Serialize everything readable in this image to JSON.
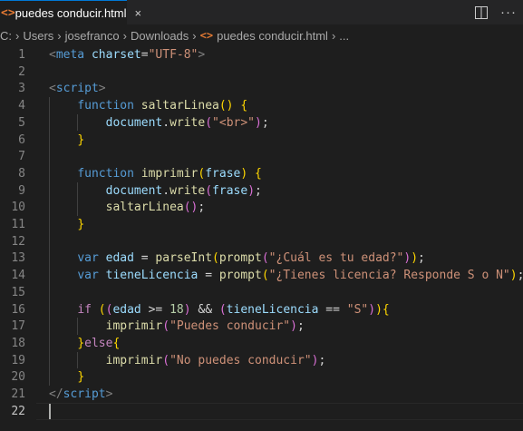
{
  "tab": {
    "icon": "<>",
    "title": "puedes conducir.html",
    "close": "×"
  },
  "actions": {
    "split": "split-editor-icon",
    "more": "···"
  },
  "breadcrumb": {
    "items": [
      "C:",
      "Users",
      "josefranco",
      "Downloads"
    ],
    "separator": "›",
    "file_icon": "<>",
    "file": "puedes conducir.html",
    "trail": "..."
  },
  "editor": {
    "current_line": 22,
    "lines": [
      {
        "n": "1",
        "tokens": [
          [
            "t-br",
            "<"
          ],
          [
            "t-tag",
            "meta"
          ],
          [
            "t-p",
            " "
          ],
          [
            "t-attr",
            "charset"
          ],
          [
            "t-p",
            "="
          ],
          [
            "t-str",
            "\"UTF-8\""
          ],
          [
            "t-br",
            ">"
          ]
        ]
      },
      {
        "n": "2",
        "tokens": []
      },
      {
        "n": "3",
        "tokens": [
          [
            "t-br",
            "<"
          ],
          [
            "t-tag",
            "script"
          ],
          [
            "t-br",
            ">"
          ]
        ]
      },
      {
        "n": "4",
        "tokens": [
          [
            "t-p",
            "    "
          ],
          [
            "t-kw",
            "function"
          ],
          [
            "t-p",
            " "
          ],
          [
            "t-fn",
            "saltarLinea"
          ],
          [
            "t-b1",
            "()"
          ],
          [
            "t-p",
            " "
          ],
          [
            "t-b1",
            "{"
          ]
        ]
      },
      {
        "n": "5",
        "tokens": [
          [
            "t-p",
            "        "
          ],
          [
            "t-var",
            "document"
          ],
          [
            "t-p",
            "."
          ],
          [
            "t-fn",
            "write"
          ],
          [
            "t-b2",
            "("
          ],
          [
            "t-str",
            "\"<br>\""
          ],
          [
            "t-b2",
            ")"
          ],
          [
            "t-p",
            ";"
          ]
        ]
      },
      {
        "n": "6",
        "tokens": [
          [
            "t-p",
            "    "
          ],
          [
            "t-b1",
            "}"
          ]
        ]
      },
      {
        "n": "7",
        "tokens": []
      },
      {
        "n": "8",
        "tokens": [
          [
            "t-p",
            "    "
          ],
          [
            "t-kw",
            "function"
          ],
          [
            "t-p",
            " "
          ],
          [
            "t-fn",
            "imprimir"
          ],
          [
            "t-b1",
            "("
          ],
          [
            "t-var",
            "frase"
          ],
          [
            "t-b1",
            ")"
          ],
          [
            "t-p",
            " "
          ],
          [
            "t-b1",
            "{"
          ]
        ]
      },
      {
        "n": "9",
        "tokens": [
          [
            "t-p",
            "        "
          ],
          [
            "t-var",
            "document"
          ],
          [
            "t-p",
            "."
          ],
          [
            "t-fn",
            "write"
          ],
          [
            "t-b2",
            "("
          ],
          [
            "t-var",
            "frase"
          ],
          [
            "t-b2",
            ")"
          ],
          [
            "t-p",
            ";"
          ]
        ]
      },
      {
        "n": "10",
        "tokens": [
          [
            "t-p",
            "        "
          ],
          [
            "t-fn",
            "saltarLinea"
          ],
          [
            "t-b2",
            "()"
          ],
          [
            "t-p",
            ";"
          ]
        ]
      },
      {
        "n": "11",
        "tokens": [
          [
            "t-p",
            "    "
          ],
          [
            "t-b1",
            "}"
          ]
        ]
      },
      {
        "n": "12",
        "tokens": []
      },
      {
        "n": "13",
        "tokens": [
          [
            "t-p",
            "    "
          ],
          [
            "t-kw",
            "var"
          ],
          [
            "t-p",
            " "
          ],
          [
            "t-var",
            "edad"
          ],
          [
            "t-p",
            " = "
          ],
          [
            "t-fn",
            "parseInt"
          ],
          [
            "t-b1",
            "("
          ],
          [
            "t-fn",
            "prompt"
          ],
          [
            "t-b2",
            "("
          ],
          [
            "t-str",
            "\"¿Cuál es tu edad?\""
          ],
          [
            "t-b2",
            ")"
          ],
          [
            "t-b1",
            ")"
          ],
          [
            "t-p",
            ";"
          ]
        ]
      },
      {
        "n": "14",
        "tokens": [
          [
            "t-p",
            "    "
          ],
          [
            "t-kw",
            "var"
          ],
          [
            "t-p",
            " "
          ],
          [
            "t-var",
            "tieneLicencia"
          ],
          [
            "t-p",
            " = "
          ],
          [
            "t-fn",
            "prompt"
          ],
          [
            "t-b1",
            "("
          ],
          [
            "t-str",
            "\"¿Tienes licencia? Responde S o N\""
          ],
          [
            "t-b1",
            ")"
          ],
          [
            "t-p",
            ";"
          ]
        ]
      },
      {
        "n": "15",
        "tokens": []
      },
      {
        "n": "16",
        "tokens": [
          [
            "t-p",
            "    "
          ],
          [
            "t-ctl",
            "if"
          ],
          [
            "t-p",
            " "
          ],
          [
            "t-b1",
            "("
          ],
          [
            "t-b2",
            "("
          ],
          [
            "t-var",
            "edad"
          ],
          [
            "t-p",
            " >= "
          ],
          [
            "t-num",
            "18"
          ],
          [
            "t-b2",
            ")"
          ],
          [
            "t-p",
            " && "
          ],
          [
            "t-b2",
            "("
          ],
          [
            "t-var",
            "tieneLicencia"
          ],
          [
            "t-p",
            " == "
          ],
          [
            "t-str",
            "\"S\""
          ],
          [
            "t-b2",
            ")"
          ],
          [
            "t-b1",
            ")"
          ],
          [
            "t-b1",
            "{"
          ]
        ]
      },
      {
        "n": "17",
        "tokens": [
          [
            "t-p",
            "        "
          ],
          [
            "t-fn",
            "imprimir"
          ],
          [
            "t-b2",
            "("
          ],
          [
            "t-str",
            "\"Puedes conducir\""
          ],
          [
            "t-b2",
            ")"
          ],
          [
            "t-p",
            ";"
          ]
        ]
      },
      {
        "n": "18",
        "tokens": [
          [
            "t-p",
            "    "
          ],
          [
            "t-b1",
            "}"
          ],
          [
            "t-ctl",
            "else"
          ],
          [
            "t-b1",
            "{"
          ]
        ]
      },
      {
        "n": "19",
        "tokens": [
          [
            "t-p",
            "        "
          ],
          [
            "t-fn",
            "imprimir"
          ],
          [
            "t-b2",
            "("
          ],
          [
            "t-str",
            "\"No puedes conducir\""
          ],
          [
            "t-b2",
            ")"
          ],
          [
            "t-p",
            ";"
          ]
        ]
      },
      {
        "n": "20",
        "tokens": [
          [
            "t-p",
            "    "
          ],
          [
            "t-b1",
            "}"
          ]
        ]
      },
      {
        "n": "21",
        "tokens": [
          [
            "t-br",
            "</"
          ],
          [
            "t-tag",
            "script"
          ],
          [
            "t-br",
            ">"
          ]
        ]
      },
      {
        "n": "22",
        "tokens": []
      }
    ]
  }
}
